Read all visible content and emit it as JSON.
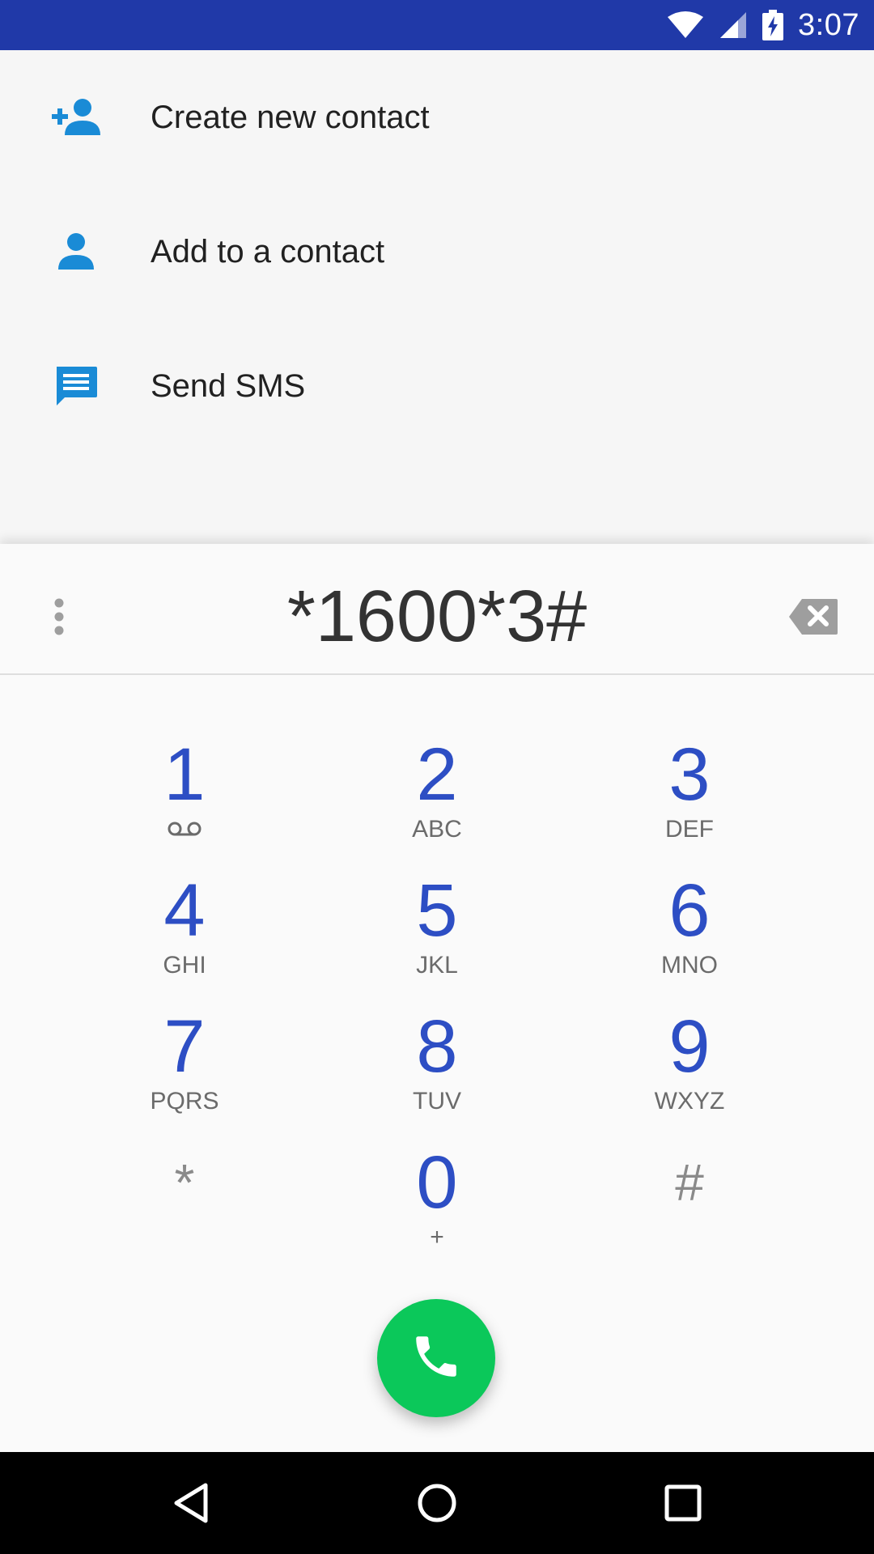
{
  "status_bar": {
    "time": "3:07",
    "icons": [
      "wifi-icon",
      "cell-signal-icon",
      "battery-charging-icon"
    ],
    "background_color": "#2039a8"
  },
  "actions": [
    {
      "label": "Create new contact",
      "icon": "add-person-icon"
    },
    {
      "label": "Add to a contact",
      "icon": "person-icon"
    },
    {
      "label": "Send SMS",
      "icon": "message-icon"
    }
  ],
  "dialpad": {
    "digits": "*1600*3#",
    "overflow_icon": "more-vert-icon",
    "backspace_icon": "backspace-icon",
    "keys": [
      {
        "digit": "1",
        "letters": "",
        "sub_icon": "voicemail-icon"
      },
      {
        "digit": "2",
        "letters": "ABC"
      },
      {
        "digit": "3",
        "letters": "DEF"
      },
      {
        "digit": "4",
        "letters": "GHI"
      },
      {
        "digit": "5",
        "letters": "JKL"
      },
      {
        "digit": "6",
        "letters": "MNO"
      },
      {
        "digit": "7",
        "letters": "PQRS"
      },
      {
        "digit": "8",
        "letters": "TUV"
      },
      {
        "digit": "9",
        "letters": "WXYZ"
      },
      {
        "digit": "*",
        "letters": ""
      },
      {
        "digit": "0",
        "letters": "+"
      },
      {
        "digit": "#",
        "letters": ""
      }
    ],
    "call_button_icon": "phone-icon",
    "accent_color": "#2d4ec4",
    "call_color": "#0bc85a",
    "action_icon_color": "#1a8bd6"
  },
  "nav_bar": {
    "buttons": [
      "back-icon",
      "home-icon",
      "recents-icon"
    ]
  }
}
